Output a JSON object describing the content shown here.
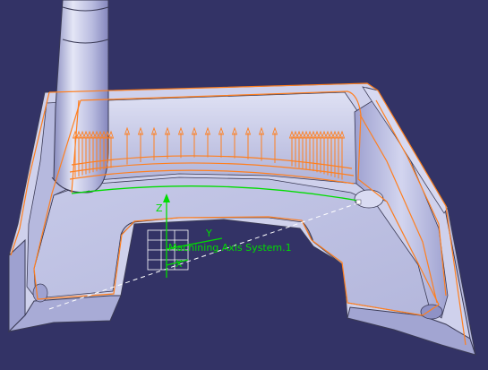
{
  "viewport": {
    "background": "#333366",
    "part_color": "#c8cbe8",
    "part_shade": "#9da0cf",
    "part_dark": "#7a7db8",
    "toolpath_color": "#ff7f1f",
    "guide_color": "#00dd00",
    "edge_color": "#3a3a55"
  },
  "axis_system": {
    "label": "Machining Axis System.1",
    "x_label": "X",
    "y_label": "Y",
    "z_label": "Z"
  }
}
